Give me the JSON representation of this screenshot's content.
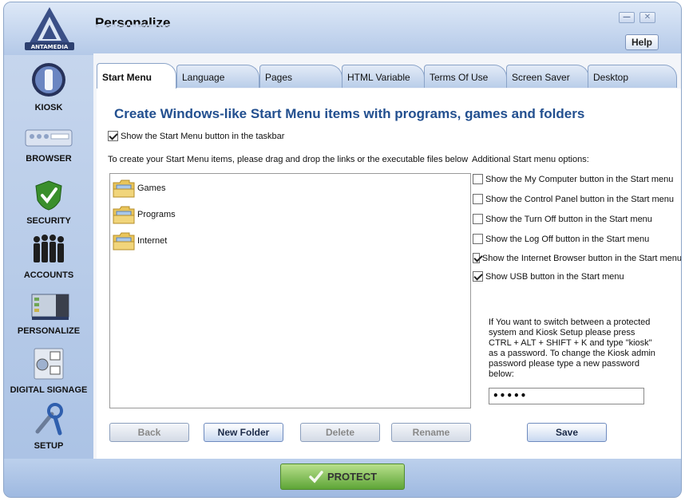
{
  "window": {
    "title": "Personalize",
    "minimize_glyph": "—",
    "close_glyph": "✕",
    "help_label": "Help"
  },
  "logo": {
    "text": "ANTAMEDIA"
  },
  "sidebar": {
    "items": [
      {
        "label": "KIOSK",
        "icon": "kiosk-icon"
      },
      {
        "label": "BROWSER",
        "icon": "browser-icon"
      },
      {
        "label": "SECURITY",
        "icon": "security-shield-icon"
      },
      {
        "label": "ACCOUNTS",
        "icon": "accounts-people-icon"
      },
      {
        "label": "PERSONALIZE",
        "icon": "personalize-screen-icon"
      },
      {
        "label": "DIGITAL SIGNAGE",
        "icon": "digital-signage-icon"
      },
      {
        "label": "SETUP",
        "icon": "setup-tools-icon"
      }
    ]
  },
  "tabs": [
    "Start Menu",
    "Language",
    "Pages",
    "HTML Variable",
    "Terms Of Use",
    "Screen Saver",
    "Desktop"
  ],
  "active_tab": "Start Menu",
  "main": {
    "headline": "Create Windows-like Start Menu items with programs, games and folders",
    "show_start_button": {
      "label": "Show the Start Menu button in the taskbar",
      "checked": true
    },
    "drag_hint": "To create your Start Menu items, please drag and drop the links or the executable files below",
    "folders": [
      "Games",
      "Programs",
      "Internet"
    ],
    "additional_title": "Additional Start menu options:",
    "options": [
      {
        "label": "Show the My Computer button in the Start menu",
        "checked": false
      },
      {
        "label": "Show the Control Panel button in the Start menu",
        "checked": false
      },
      {
        "label": "Show the Turn Off button in the Start menu",
        "checked": false
      },
      {
        "label": "Show the Log Off button in the Start menu",
        "checked": false
      },
      {
        "label": "Show the Internet Browser button in the Start menu",
        "checked": true
      },
      {
        "label": "Show USB button in the Start menu",
        "checked": true
      }
    ],
    "password_info": "If You want to switch between a protected system and Kiosk Setup please press CTRL + ALT + SHIFT + K and type \"kiosk\" as a password. To change the Kiosk admin password please type a new password below:",
    "password_value": "•••••",
    "buttons": {
      "back": "Back",
      "new_folder": "New Folder",
      "delete": "Delete",
      "rename": "Rename",
      "save": "Save"
    }
  },
  "footer": {
    "protect_label": "PROTECT"
  },
  "colors": {
    "headline": "#224f8f",
    "protect_green": "#5ea537",
    "frame_blue": "#a9c1e4"
  }
}
